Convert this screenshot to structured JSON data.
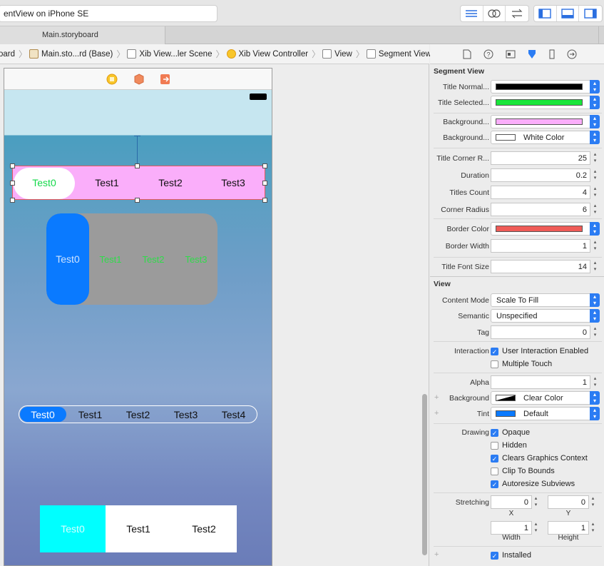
{
  "toolbar": {
    "scheme_text": "entView on iPhone SE"
  },
  "tabs": [
    {
      "label": "Main.storyboard"
    }
  ],
  "breadcrumb": [
    "oard",
    "Main.sto...rd (Base)",
    "Xib View...ler Scene",
    "Xib View Controller",
    "View",
    "Segment View"
  ],
  "segments": {
    "seg1": [
      "Test0",
      "Test1",
      "Test2",
      "Test3"
    ],
    "seg2": [
      "Test0",
      "Test1",
      "Test2",
      "Test3"
    ],
    "seg3": [
      "Test0",
      "Test1",
      "Test2",
      "Test3",
      "Test4"
    ],
    "seg4": [
      "Test0",
      "Test1",
      "Test2"
    ]
  },
  "colors": {
    "seg1_bg": "#faaefa",
    "seg1_selected_text": "#14d94a",
    "seg2_selected": "#0a7aff",
    "seg2_text": "#2fdc4a",
    "seg4_selected": "#00ffff",
    "accent": "#2b7cf3"
  },
  "inspector": {
    "segment_view": {
      "title": "Segment View",
      "title_normal_label": "Title Normal...",
      "title_normal_color": "#000000",
      "title_selected_label": "Title Selected...",
      "title_selected_color": "#19e63a",
      "background1_label": "Background...",
      "background1_color": "#faaefa",
      "background2_label": "Background...",
      "background2_value": "White Color",
      "corner_r_label": "Title Corner R...",
      "corner_r_value": "25",
      "duration_label": "Duration",
      "duration_value": "0.2",
      "titles_count_label": "Titles Count",
      "titles_count_value": "4",
      "corner_radius_label": "Corner Radius",
      "corner_radius_value": "6",
      "border_color_label": "Border Color",
      "border_color": "#ef5b57",
      "border_width_label": "Border Width",
      "border_width_value": "1",
      "title_font_size_label": "Title Font Size",
      "title_font_size_value": "14"
    },
    "view": {
      "title": "View",
      "content_mode_label": "Content Mode",
      "content_mode_value": "Scale To Fill",
      "semantic_label": "Semantic",
      "semantic_value": "Unspecified",
      "tag_label": "Tag",
      "tag_value": "0",
      "interaction_label": "Interaction",
      "user_interaction": "User Interaction Enabled",
      "multiple_touch": "Multiple Touch",
      "alpha_label": "Alpha",
      "alpha_value": "1",
      "background_label": "Background",
      "background_value": "Clear Color",
      "tint_label": "Tint",
      "tint_value": "Default",
      "drawing_label": "Drawing",
      "opaque": "Opaque",
      "hidden": "Hidden",
      "clears_graphics": "Clears Graphics Context",
      "clip_to_bounds": "Clip To Bounds",
      "autoresize": "Autoresize Subviews",
      "stretching_label": "Stretching",
      "x_value": "0",
      "y_value": "0",
      "x_label": "X",
      "y_label": "Y",
      "width_value": "1",
      "height_value": "1",
      "width_label": "Width",
      "height_label": "Height",
      "installed": "Installed"
    }
  }
}
